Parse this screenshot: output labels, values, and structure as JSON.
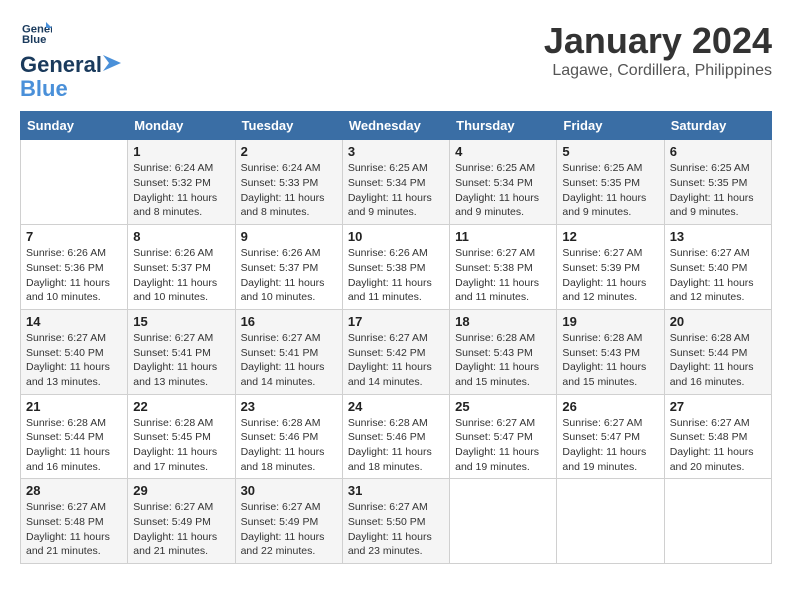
{
  "logo": {
    "line1": "General",
    "line2": "Blue"
  },
  "title": "January 2024",
  "location": "Lagawe, Cordillera, Philippines",
  "weekdays": [
    "Sunday",
    "Monday",
    "Tuesday",
    "Wednesday",
    "Thursday",
    "Friday",
    "Saturday"
  ],
  "weeks": [
    [
      {
        "day": "",
        "sunrise": "",
        "sunset": "",
        "daylight": ""
      },
      {
        "day": "1",
        "sunrise": "Sunrise: 6:24 AM",
        "sunset": "Sunset: 5:32 PM",
        "daylight": "Daylight: 11 hours and 8 minutes."
      },
      {
        "day": "2",
        "sunrise": "Sunrise: 6:24 AM",
        "sunset": "Sunset: 5:33 PM",
        "daylight": "Daylight: 11 hours and 8 minutes."
      },
      {
        "day": "3",
        "sunrise": "Sunrise: 6:25 AM",
        "sunset": "Sunset: 5:34 PM",
        "daylight": "Daylight: 11 hours and 9 minutes."
      },
      {
        "day": "4",
        "sunrise": "Sunrise: 6:25 AM",
        "sunset": "Sunset: 5:34 PM",
        "daylight": "Daylight: 11 hours and 9 minutes."
      },
      {
        "day": "5",
        "sunrise": "Sunrise: 6:25 AM",
        "sunset": "Sunset: 5:35 PM",
        "daylight": "Daylight: 11 hours and 9 minutes."
      },
      {
        "day": "6",
        "sunrise": "Sunrise: 6:25 AM",
        "sunset": "Sunset: 5:35 PM",
        "daylight": "Daylight: 11 hours and 9 minutes."
      }
    ],
    [
      {
        "day": "7",
        "sunrise": "Sunrise: 6:26 AM",
        "sunset": "Sunset: 5:36 PM",
        "daylight": "Daylight: 11 hours and 10 minutes."
      },
      {
        "day": "8",
        "sunrise": "Sunrise: 6:26 AM",
        "sunset": "Sunset: 5:37 PM",
        "daylight": "Daylight: 11 hours and 10 minutes."
      },
      {
        "day": "9",
        "sunrise": "Sunrise: 6:26 AM",
        "sunset": "Sunset: 5:37 PM",
        "daylight": "Daylight: 11 hours and 10 minutes."
      },
      {
        "day": "10",
        "sunrise": "Sunrise: 6:26 AM",
        "sunset": "Sunset: 5:38 PM",
        "daylight": "Daylight: 11 hours and 11 minutes."
      },
      {
        "day": "11",
        "sunrise": "Sunrise: 6:27 AM",
        "sunset": "Sunset: 5:38 PM",
        "daylight": "Daylight: 11 hours and 11 minutes."
      },
      {
        "day": "12",
        "sunrise": "Sunrise: 6:27 AM",
        "sunset": "Sunset: 5:39 PM",
        "daylight": "Daylight: 11 hours and 12 minutes."
      },
      {
        "day": "13",
        "sunrise": "Sunrise: 6:27 AM",
        "sunset": "Sunset: 5:40 PM",
        "daylight": "Daylight: 11 hours and 12 minutes."
      }
    ],
    [
      {
        "day": "14",
        "sunrise": "Sunrise: 6:27 AM",
        "sunset": "Sunset: 5:40 PM",
        "daylight": "Daylight: 11 hours and 13 minutes."
      },
      {
        "day": "15",
        "sunrise": "Sunrise: 6:27 AM",
        "sunset": "Sunset: 5:41 PM",
        "daylight": "Daylight: 11 hours and 13 minutes."
      },
      {
        "day": "16",
        "sunrise": "Sunrise: 6:27 AM",
        "sunset": "Sunset: 5:41 PM",
        "daylight": "Daylight: 11 hours and 14 minutes."
      },
      {
        "day": "17",
        "sunrise": "Sunrise: 6:27 AM",
        "sunset": "Sunset: 5:42 PM",
        "daylight": "Daylight: 11 hours and 14 minutes."
      },
      {
        "day": "18",
        "sunrise": "Sunrise: 6:28 AM",
        "sunset": "Sunset: 5:43 PM",
        "daylight": "Daylight: 11 hours and 15 minutes."
      },
      {
        "day": "19",
        "sunrise": "Sunrise: 6:28 AM",
        "sunset": "Sunset: 5:43 PM",
        "daylight": "Daylight: 11 hours and 15 minutes."
      },
      {
        "day": "20",
        "sunrise": "Sunrise: 6:28 AM",
        "sunset": "Sunset: 5:44 PM",
        "daylight": "Daylight: 11 hours and 16 minutes."
      }
    ],
    [
      {
        "day": "21",
        "sunrise": "Sunrise: 6:28 AM",
        "sunset": "Sunset: 5:44 PM",
        "daylight": "Daylight: 11 hours and 16 minutes."
      },
      {
        "day": "22",
        "sunrise": "Sunrise: 6:28 AM",
        "sunset": "Sunset: 5:45 PM",
        "daylight": "Daylight: 11 hours and 17 minutes."
      },
      {
        "day": "23",
        "sunrise": "Sunrise: 6:28 AM",
        "sunset": "Sunset: 5:46 PM",
        "daylight": "Daylight: 11 hours and 18 minutes."
      },
      {
        "day": "24",
        "sunrise": "Sunrise: 6:28 AM",
        "sunset": "Sunset: 5:46 PM",
        "daylight": "Daylight: 11 hours and 18 minutes."
      },
      {
        "day": "25",
        "sunrise": "Sunrise: 6:27 AM",
        "sunset": "Sunset: 5:47 PM",
        "daylight": "Daylight: 11 hours and 19 minutes."
      },
      {
        "day": "26",
        "sunrise": "Sunrise: 6:27 AM",
        "sunset": "Sunset: 5:47 PM",
        "daylight": "Daylight: 11 hours and 19 minutes."
      },
      {
        "day": "27",
        "sunrise": "Sunrise: 6:27 AM",
        "sunset": "Sunset: 5:48 PM",
        "daylight": "Daylight: 11 hours and 20 minutes."
      }
    ],
    [
      {
        "day": "28",
        "sunrise": "Sunrise: 6:27 AM",
        "sunset": "Sunset: 5:48 PM",
        "daylight": "Daylight: 11 hours and 21 minutes."
      },
      {
        "day": "29",
        "sunrise": "Sunrise: 6:27 AM",
        "sunset": "Sunset: 5:49 PM",
        "daylight": "Daylight: 11 hours and 21 minutes."
      },
      {
        "day": "30",
        "sunrise": "Sunrise: 6:27 AM",
        "sunset": "Sunset: 5:49 PM",
        "daylight": "Daylight: 11 hours and 22 minutes."
      },
      {
        "day": "31",
        "sunrise": "Sunrise: 6:27 AM",
        "sunset": "Sunset: 5:50 PM",
        "daylight": "Daylight: 11 hours and 23 minutes."
      },
      {
        "day": "",
        "sunrise": "",
        "sunset": "",
        "daylight": ""
      },
      {
        "day": "",
        "sunrise": "",
        "sunset": "",
        "daylight": ""
      },
      {
        "day": "",
        "sunrise": "",
        "sunset": "",
        "daylight": ""
      }
    ]
  ]
}
